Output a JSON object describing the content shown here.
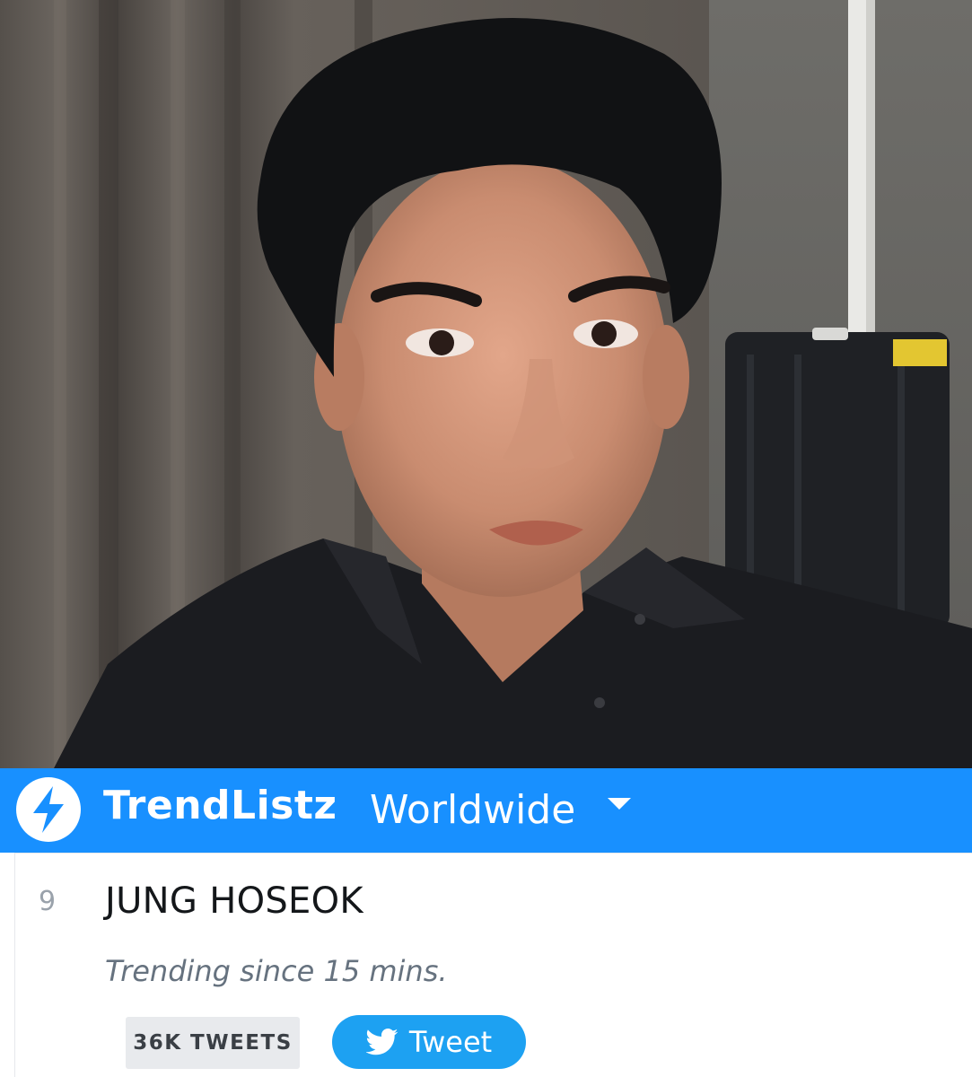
{
  "header": {
    "brand": "TrendListz",
    "region": "Worldwide",
    "logo_icon": "lightning-bolt-icon",
    "dropdown_icon": "caret-down-icon",
    "accent_color": "#1890ff"
  },
  "trend": {
    "rank": "9",
    "name": "JUNG HOSEOK",
    "since": "Trending since 15 mins.",
    "tweet_count": "36K TWEETS",
    "tweet_button_label": "Tweet",
    "tweet_button_icon": "twitter-bird-icon",
    "tweet_button_color": "#1da1f2"
  }
}
